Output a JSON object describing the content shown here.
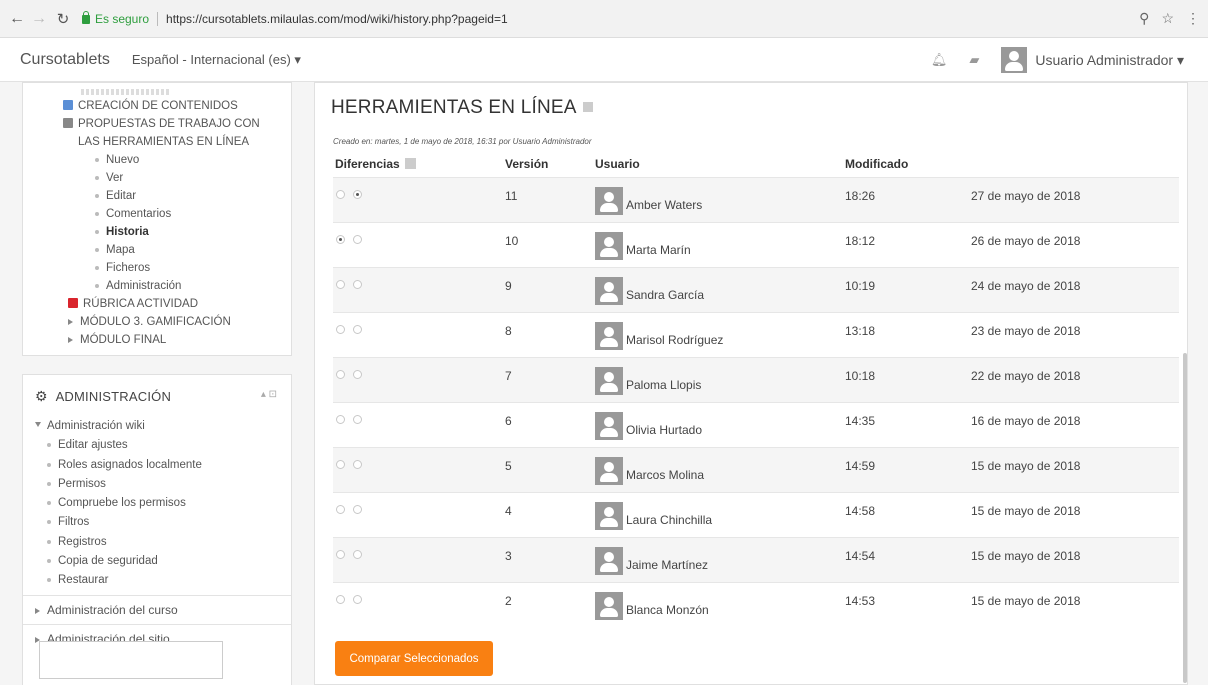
{
  "browser": {
    "secure_label": "Es seguro",
    "url": "https://cursotablets.milaulas.com/mod/wiki/history.php?pageid=1"
  },
  "navbar": {
    "brand": "Cursotablets",
    "language": "Español - Internacional (es) ▾",
    "user_name": "Usuario Administrador ▾"
  },
  "nav_tree": {
    "items": [
      {
        "label": "CREACIÓN DE CONTENIDOS"
      },
      {
        "label": "PROPUESTAS DE TRABAJO CON"
      },
      {
        "label": "LAS HERRAMIENTAS EN LÍNEA"
      },
      {
        "label": "Nuevo"
      },
      {
        "label": "Ver"
      },
      {
        "label": "Editar"
      },
      {
        "label": "Comentarios"
      },
      {
        "label": "Historia"
      },
      {
        "label": "Mapa"
      },
      {
        "label": "Ficheros"
      },
      {
        "label": "Administración"
      },
      {
        "label": "RÚBRICA ACTIVIDAD"
      },
      {
        "label": "MÓDULO 3. GAMIFICACIÓN"
      },
      {
        "label": "MÓDULO FINAL"
      }
    ]
  },
  "admin": {
    "title": "ADMINISTRACIÓN",
    "wiki_label": "Administración wiki",
    "items": [
      {
        "label": "Editar ajustes"
      },
      {
        "label": "Roles asignados localmente"
      },
      {
        "label": "Permisos"
      },
      {
        "label": "Compruebe los permisos"
      },
      {
        "label": "Filtros"
      },
      {
        "label": "Registros"
      },
      {
        "label": "Copia de seguridad"
      },
      {
        "label": "Restaurar"
      }
    ],
    "course_label": "Administración del curso",
    "site_label": "Administración del sitio"
  },
  "main": {
    "title": "HERRAMIENTAS EN LÍNEA",
    "created": "Creado en: martes, 1 de mayo de 2018, 16:31 por Usuario Administrador",
    "headers": {
      "diff": "Diferencias",
      "version": "Versión",
      "user": "Usuario",
      "modified": "Modificado"
    },
    "rows": [
      {
        "version": "11",
        "user": "Amber Waters",
        "time": "18:26",
        "date": "27 de mayo de 2018",
        "radio_a": false,
        "radio_b": true
      },
      {
        "version": "10",
        "user": "Marta Marín",
        "time": "18:12",
        "date": "26 de mayo de 2018",
        "radio_a": true,
        "radio_b": false
      },
      {
        "version": "9",
        "user": "Sandra García",
        "time": "10:19",
        "date": "24 de mayo de 2018",
        "radio_a": false,
        "radio_b": false
      },
      {
        "version": "8",
        "user": "Marisol Rodríguez",
        "time": "13:18",
        "date": "23 de mayo de 2018",
        "radio_a": false,
        "radio_b": false
      },
      {
        "version": "7",
        "user": "Paloma Llopis",
        "time": "10:18",
        "date": "22 de mayo de 2018",
        "radio_a": false,
        "radio_b": false
      },
      {
        "version": "6",
        "user": "Olivia Hurtado",
        "time": "14:35",
        "date": "16 de mayo de 2018",
        "radio_a": false,
        "radio_b": false
      },
      {
        "version": "5",
        "user": "Marcos Molina",
        "time": "14:59",
        "date": "15 de mayo de 2018",
        "radio_a": false,
        "radio_b": false
      },
      {
        "version": "4",
        "user": "Laura Chinchilla",
        "time": "14:58",
        "date": "15 de mayo de 2018",
        "radio_a": false,
        "radio_b": false
      },
      {
        "version": "3",
        "user": "Jaime Martínez",
        "time": "14:54",
        "date": "15 de mayo de 2018",
        "radio_a": false,
        "radio_b": false
      },
      {
        "version": "2",
        "user": "Blanca Monzón",
        "time": "14:53",
        "date": "15 de mayo de 2018",
        "radio_a": false,
        "radio_b": false
      }
    ],
    "compare_button": "Comparar Seleccionados"
  },
  "colors": {
    "accent": "#f98012",
    "secure": "#2e9e3e"
  }
}
